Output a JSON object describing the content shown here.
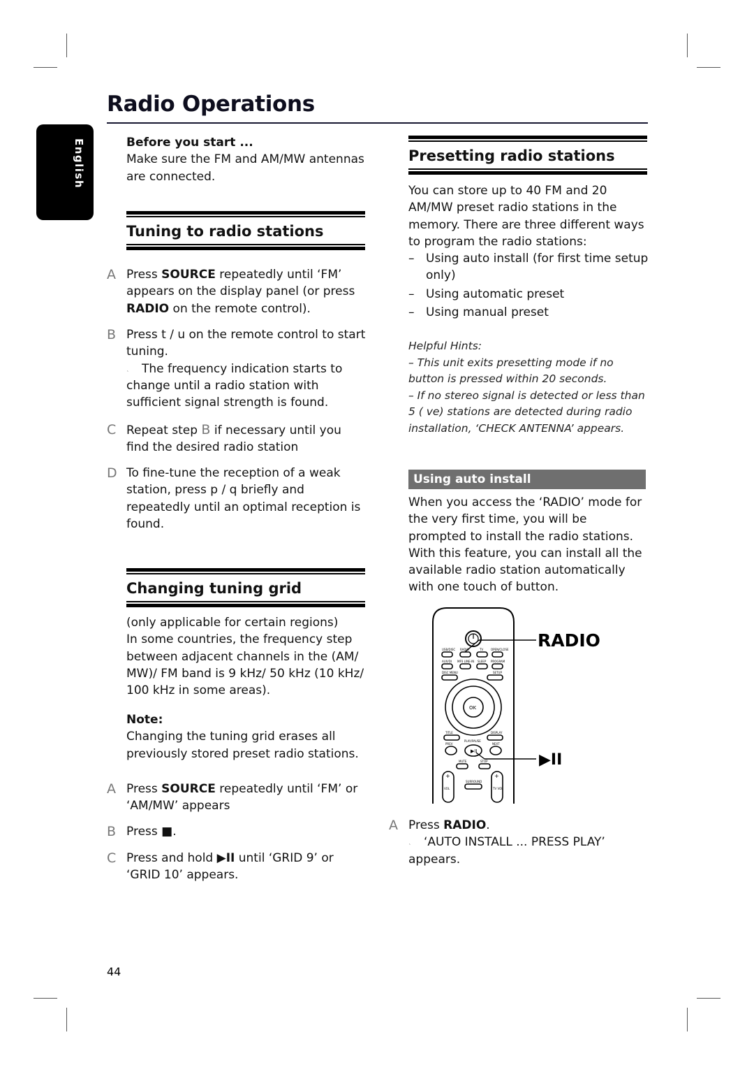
{
  "page": {
    "title": "Radio Operations",
    "language_tab": "English",
    "page_number": "44"
  },
  "before_start": {
    "heading": "Before you start ...",
    "text": "Make sure the FM and AM/MW antennas are connected."
  },
  "tuning": {
    "heading": "Tuning to radio stations",
    "steps": [
      {
        "letter": "A",
        "pre": "Press ",
        "bold1": "SOURCE",
        "mid": " repeatedly until ‘FM’ appears on the display panel (or press ",
        "bold2": "RADIO",
        "post": " on the remote control)."
      },
      {
        "letter": "B",
        "text": "Press t  / u  on the remote control to start tuning.",
        "result_marker": "˛",
        "result": "The frequency indication starts to change until a radio station with sufficient signal strength is found."
      },
      {
        "letter": "C",
        "pre": "Repeat step ",
        "ref": "B",
        "post": "  if necessary until you find the desired radio station"
      },
      {
        "letter": "D",
        "text": "To fine-tune the reception of a weak station, press p  / q  briefly and repeatedly until an optimal reception is found."
      }
    ]
  },
  "grid": {
    "heading": "Changing tuning grid",
    "intro1": "(only applicable for certain regions)",
    "intro2": "In some countries, the frequency step between adjacent channels in the (AM/ MW)/ FM band is 9 kHz/ 50 kHz (10 kHz/ 100 kHz in some areas).",
    "note_heading": "Note:",
    "note_text": "Changing the tuning grid erases all previously stored preset radio stations.",
    "steps": [
      {
        "letter": "A",
        "pre": "Press ",
        "bold": "SOURCE",
        "post": " repeatedly until ‘FM’ or ‘AM/MW’ appears"
      },
      {
        "letter": "B",
        "pre": "Press ",
        "symbol": "■",
        "post": "."
      },
      {
        "letter": "C",
        "pre": "Press and hold ",
        "symbol": "▶II",
        "post": " until ‘GRID 9’ or ‘GRID 10’ appears."
      }
    ]
  },
  "presetting": {
    "heading": "Presetting radio stations",
    "intro": "You can store up to 40 FM and 20 AM/MW preset radio stations in the memory. There are three different ways to program the radio stations:",
    "methods": [
      "Using auto install (for first time setup only)",
      "Using automatic preset",
      "Using manual preset"
    ],
    "hints": {
      "heading": "Helpful Hints:",
      "items": [
        "– This unit exits presetting mode if no button is pressed within 20 seconds.",
        "– If no stereo signal is detected or less than 5 (  ve) stations are detected during radio installation, ‘CHECK ANTENNA’ appears."
      ]
    }
  },
  "auto_install": {
    "heading": "Using auto install",
    "text": "When you access the ‘RADIO’ mode for the very first time, you will be prompted to install the radio stations.  With this feature, you can install all the available radio station automatically with one touch of button.",
    "steps": [
      {
        "letter": "A",
        "pre": "Press ",
        "bold": "RADIO",
        "post": ".",
        "result_marker": "˛",
        "result": "‘AUTO INSTALL ... PRESS PLAY’ appears."
      }
    ]
  },
  "remote": {
    "callout_radio": "RADIO",
    "callout_play": "▶II",
    "buttons_row1": [
      "USB/DISC",
      "RADIO",
      "TV",
      "OPEN/CLOSE"
    ],
    "buttons_row2": [
      "AUX/DI",
      "MP3 LINE-IN",
      "SLEEP",
      "PROGRAM"
    ],
    "buttons_row3": [
      "DISC MENU",
      "SETUP"
    ],
    "nav_center": "OK",
    "buttons_row4": [
      "TITLE",
      "DISPLAY"
    ],
    "buttons_row5": [
      "PREV",
      "PLAY/PAUSE",
      "NEXT"
    ],
    "buttons_row6": [
      "MUTE",
      "STOP"
    ],
    "vol": "VOL",
    "surround": "SURROUND",
    "tv_vol": "TV VOL"
  }
}
